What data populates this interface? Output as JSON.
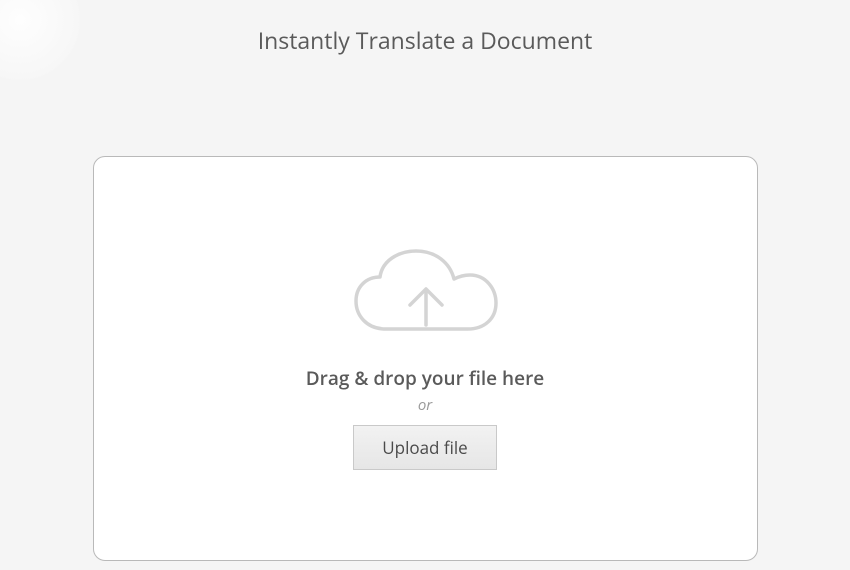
{
  "header": {
    "title": "Instantly Translate a Document"
  },
  "dropzone": {
    "instruction": "Drag & drop your file here",
    "separator": "or",
    "button_label": "Upload file"
  }
}
